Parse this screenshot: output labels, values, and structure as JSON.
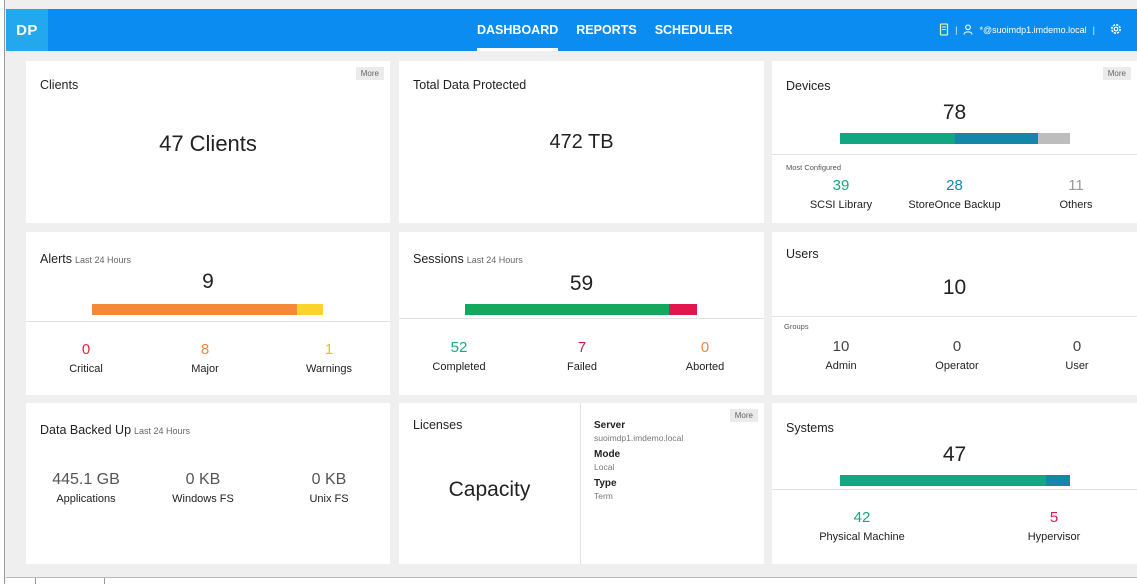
{
  "app": {
    "logo": "DP"
  },
  "nav": [
    {
      "label": "DASHBOARD",
      "active": true
    },
    {
      "label": "REPORTS",
      "active": false
    },
    {
      "label": "SCHEDULER",
      "active": false
    }
  ],
  "header": {
    "user": "*@suoimdp1.imdemo.local",
    "sep1": "|",
    "sep2": "|"
  },
  "clients": {
    "title": "Clients",
    "more": "More",
    "value": "47 Clients"
  },
  "total": {
    "title": "Total Data Protected",
    "value": "472 TB"
  },
  "devices": {
    "title": "Devices",
    "more": "More",
    "value": "78",
    "section_label": "Most Configured",
    "segments": [
      {
        "value": 39,
        "color": "#12a683"
      },
      {
        "value": 28,
        "color": "#1287a8"
      },
      {
        "value": 11,
        "color": "#bdbdbd"
      }
    ],
    "stats": [
      {
        "num": "39",
        "label": "SCSI Library",
        "color": "#12a683"
      },
      {
        "num": "28",
        "label": "StoreOnce Backup",
        "color": "#1287a8"
      },
      {
        "num": "11",
        "label": "Others",
        "color": "#999999"
      }
    ]
  },
  "alerts": {
    "title": "Alerts",
    "sub": "Last 24 Hours",
    "value": "9",
    "segments": [
      {
        "value": 8,
        "color": "#f5893a"
      },
      {
        "value": 1,
        "color": "#fbd32a"
      }
    ],
    "stats": [
      {
        "num": "0",
        "label": "Critical",
        "color": "#e4263b"
      },
      {
        "num": "8",
        "label": "Major",
        "color": "#f5893a"
      },
      {
        "num": "1",
        "label": "Warnings",
        "color": "#f0bf10"
      }
    ]
  },
  "sessions": {
    "title": "Sessions",
    "sub": "Last 24 Hours",
    "value": "59",
    "segments": [
      {
        "value": 52,
        "color": "#14a85f"
      },
      {
        "value": 7,
        "color": "#e3154f"
      }
    ],
    "stats": [
      {
        "num": "52",
        "label": "Completed",
        "color": "#14a887"
      },
      {
        "num": "7",
        "label": "Failed",
        "color": "#e3154f"
      },
      {
        "num": "0",
        "label": "Aborted",
        "color": "#f5893a"
      }
    ]
  },
  "users": {
    "title": "Users",
    "value": "10",
    "section_label": "Groups",
    "stats": [
      {
        "num": "10",
        "label": "Admin",
        "color": "#444444"
      },
      {
        "num": "0",
        "label": "Operator",
        "color": "#444444"
      },
      {
        "num": "0",
        "label": "User",
        "color": "#444444"
      }
    ]
  },
  "backed": {
    "title": "Data Backed Up",
    "sub": "Last 24 Hours",
    "stats": [
      {
        "num": "445.1 GB",
        "label": "Applications",
        "color": "#555555"
      },
      {
        "num": "0 KB",
        "label": "Windows FS",
        "color": "#555555"
      },
      {
        "num": "0 KB",
        "label": "Unix FS",
        "color": "#555555"
      }
    ]
  },
  "licenses": {
    "title": "Licenses",
    "more": "More",
    "value": "Capacity",
    "server_key": "Server",
    "server_val": "suoimdp1.imdemo.local",
    "mode_key": "Mode",
    "mode_val": "Local",
    "type_key": "Type",
    "type_val": "Term"
  },
  "systems": {
    "title": "Systems",
    "value": "47",
    "segments": [
      {
        "value": 42,
        "color": "#12a683"
      },
      {
        "value": 5,
        "color": "#1287a8"
      }
    ],
    "stats": [
      {
        "num": "42",
        "label": "Physical Machine",
        "color": "#12a683"
      },
      {
        "num": "5",
        "label": "Hypervisor",
        "color": "#e3154f"
      }
    ]
  }
}
